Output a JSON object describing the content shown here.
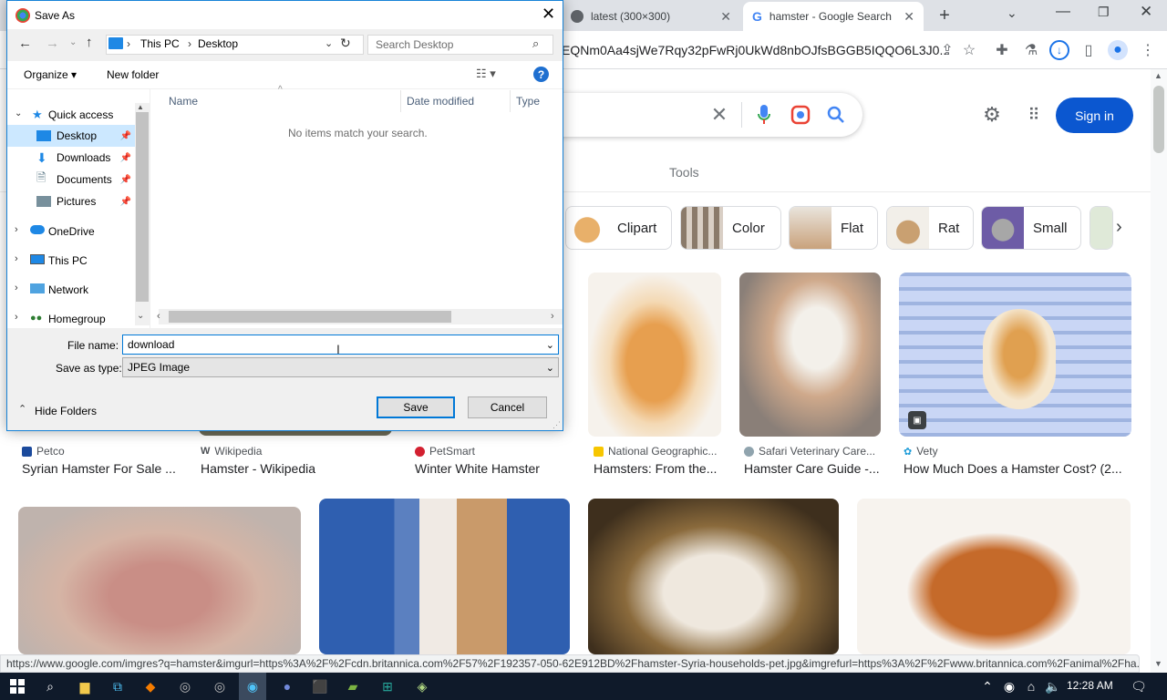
{
  "browser": {
    "tabs": [
      {
        "label": "latest (300×300)"
      },
      {
        "label": "hamster - Google Search"
      }
    ],
    "new_tab": "+",
    "url": "EQNm0Aa4sjWe7Rqy32pFwRj0UkWd8nbOJfsBGGB5IQQO6L3J0...",
    "status_url": "https://www.google.com/imgres?q=hamster&imgurl=https%3A%2F%2Fcdn.britannica.com%2F57%2F192357-050-62E912BD%2Fhamster-Syria-households-pet.jpg&imgrefurl=https%3A%2F%2Fwww.britannica.com%2Fanimal%2Fha..."
  },
  "google": {
    "sign_in": "Sign in",
    "tools": "Tools",
    "chips": [
      "Clipart",
      "Color",
      "Flat",
      "Rat",
      "Small"
    ],
    "results_row1": [
      {
        "source": "Petco",
        "title": "Syrian Hamster For Sale ...",
        "favcolor": "#1b4a9c"
      },
      {
        "source": "Wikipedia",
        "title": "Hamster - Wikipedia",
        "favcolor": "#333333"
      },
      {
        "source": "PetSmart",
        "title": "Winter White Hamster",
        "favcolor": "#d32030"
      },
      {
        "source": "National Geographic...",
        "title": "Hamsters: From the...",
        "favcolor": "#f7c600"
      },
      {
        "source": "Safari Veterinary Care...",
        "title": "Hamster Care Guide -...",
        "favcolor": "#90a4ae"
      },
      {
        "source": "Vety",
        "title": "How Much Does a Hamster Cost? (2...",
        "favcolor": "#1a9ad7"
      }
    ]
  },
  "dialog": {
    "title": "Save As",
    "breadcrumb": [
      "This PC",
      "Desktop"
    ],
    "search_placeholder": "Search Desktop",
    "organize": "Organize ▾",
    "new_folder": "New folder",
    "nav": {
      "quick_access": "Quick access",
      "items": [
        "Desktop",
        "Downloads",
        "Documents",
        "Pictures"
      ],
      "onedrive": "OneDrive",
      "this_pc": "This PC",
      "network": "Network",
      "homegroup": "Homegroup"
    },
    "columns": [
      "Name",
      "Date modified",
      "Type"
    ],
    "empty_message": "No items match your search.",
    "file_name_label": "File name:",
    "file_name_value": "download",
    "save_type_label": "Save as type:",
    "save_type_value": "JPEG Image",
    "hide_folders": "Hide Folders",
    "save_button": "Save",
    "cancel_button": "Cancel"
  },
  "taskbar": {
    "time": "12:28 AM"
  }
}
